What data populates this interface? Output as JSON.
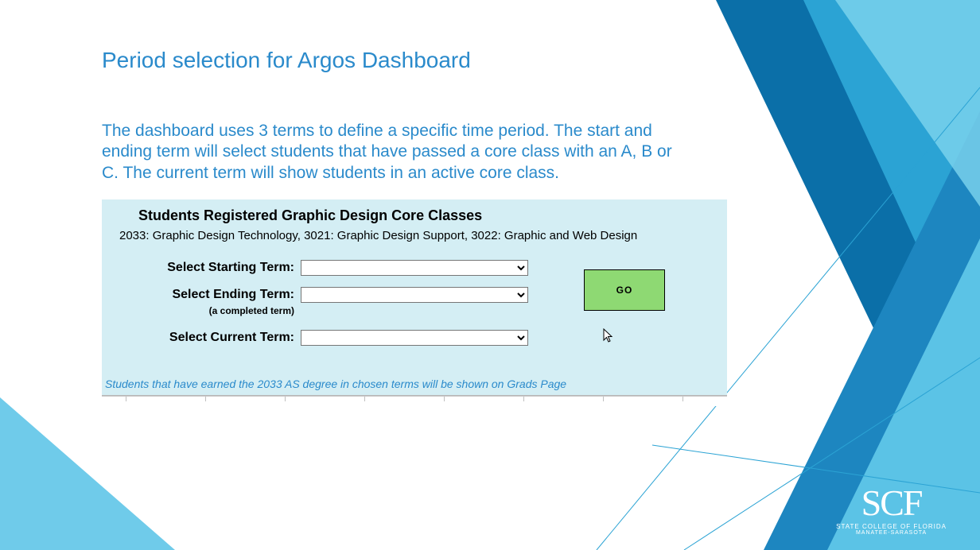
{
  "title": "Period selection for Argos Dashboard",
  "description": "The dashboard uses 3 terms to define a specific time period. The start and ending term will select students that have passed a core class with an A, B or C. The current term will show students in an active core class.",
  "panel": {
    "heading": "Students Registered Graphic Design Core Classes",
    "subheading": "2033: Graphic Design Technology,  3021: Graphic Design Support,  3022: Graphic and Web Design",
    "rows": {
      "start": {
        "label": "Select Starting Term:"
      },
      "end": {
        "label": "Select Ending Term:",
        "sub": "(a completed term)"
      },
      "curr": {
        "label": "Select Current Term:"
      }
    },
    "go": "GO",
    "footnote": "Students that have earned the 2033 AS degree in chosen terms will be shown on Grads Page"
  },
  "logo": {
    "big": "SCF",
    "line1": "STATE COLLEGE OF FLORIDA",
    "line2": "MANATEE-SARASOTA"
  }
}
